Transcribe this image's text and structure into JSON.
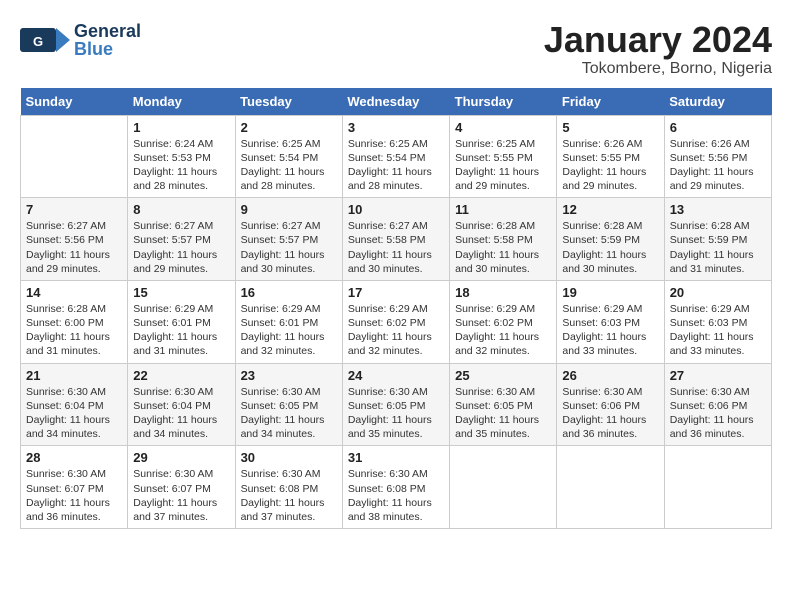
{
  "header": {
    "logo_line1": "General",
    "logo_line2": "Blue",
    "month": "January 2024",
    "location": "Tokombere, Borno, Nigeria"
  },
  "days_of_week": [
    "Sunday",
    "Monday",
    "Tuesday",
    "Wednesday",
    "Thursday",
    "Friday",
    "Saturday"
  ],
  "weeks": [
    [
      {
        "day": "",
        "info": ""
      },
      {
        "day": "1",
        "info": "Sunrise: 6:24 AM\nSunset: 5:53 PM\nDaylight: 11 hours\nand 28 minutes."
      },
      {
        "day": "2",
        "info": "Sunrise: 6:25 AM\nSunset: 5:54 PM\nDaylight: 11 hours\nand 28 minutes."
      },
      {
        "day": "3",
        "info": "Sunrise: 6:25 AM\nSunset: 5:54 PM\nDaylight: 11 hours\nand 28 minutes."
      },
      {
        "day": "4",
        "info": "Sunrise: 6:25 AM\nSunset: 5:55 PM\nDaylight: 11 hours\nand 29 minutes."
      },
      {
        "day": "5",
        "info": "Sunrise: 6:26 AM\nSunset: 5:55 PM\nDaylight: 11 hours\nand 29 minutes."
      },
      {
        "day": "6",
        "info": "Sunrise: 6:26 AM\nSunset: 5:56 PM\nDaylight: 11 hours\nand 29 minutes."
      }
    ],
    [
      {
        "day": "7",
        "info": "Sunrise: 6:27 AM\nSunset: 5:56 PM\nDaylight: 11 hours\nand 29 minutes."
      },
      {
        "day": "8",
        "info": "Sunrise: 6:27 AM\nSunset: 5:57 PM\nDaylight: 11 hours\nand 29 minutes."
      },
      {
        "day": "9",
        "info": "Sunrise: 6:27 AM\nSunset: 5:57 PM\nDaylight: 11 hours\nand 30 minutes."
      },
      {
        "day": "10",
        "info": "Sunrise: 6:27 AM\nSunset: 5:58 PM\nDaylight: 11 hours\nand 30 minutes."
      },
      {
        "day": "11",
        "info": "Sunrise: 6:28 AM\nSunset: 5:58 PM\nDaylight: 11 hours\nand 30 minutes."
      },
      {
        "day": "12",
        "info": "Sunrise: 6:28 AM\nSunset: 5:59 PM\nDaylight: 11 hours\nand 30 minutes."
      },
      {
        "day": "13",
        "info": "Sunrise: 6:28 AM\nSunset: 5:59 PM\nDaylight: 11 hours\nand 31 minutes."
      }
    ],
    [
      {
        "day": "14",
        "info": "Sunrise: 6:28 AM\nSunset: 6:00 PM\nDaylight: 11 hours\nand 31 minutes."
      },
      {
        "day": "15",
        "info": "Sunrise: 6:29 AM\nSunset: 6:01 PM\nDaylight: 11 hours\nand 31 minutes."
      },
      {
        "day": "16",
        "info": "Sunrise: 6:29 AM\nSunset: 6:01 PM\nDaylight: 11 hours\nand 32 minutes."
      },
      {
        "day": "17",
        "info": "Sunrise: 6:29 AM\nSunset: 6:02 PM\nDaylight: 11 hours\nand 32 minutes."
      },
      {
        "day": "18",
        "info": "Sunrise: 6:29 AM\nSunset: 6:02 PM\nDaylight: 11 hours\nand 32 minutes."
      },
      {
        "day": "19",
        "info": "Sunrise: 6:29 AM\nSunset: 6:03 PM\nDaylight: 11 hours\nand 33 minutes."
      },
      {
        "day": "20",
        "info": "Sunrise: 6:29 AM\nSunset: 6:03 PM\nDaylight: 11 hours\nand 33 minutes."
      }
    ],
    [
      {
        "day": "21",
        "info": "Sunrise: 6:30 AM\nSunset: 6:04 PM\nDaylight: 11 hours\nand 34 minutes."
      },
      {
        "day": "22",
        "info": "Sunrise: 6:30 AM\nSunset: 6:04 PM\nDaylight: 11 hours\nand 34 minutes."
      },
      {
        "day": "23",
        "info": "Sunrise: 6:30 AM\nSunset: 6:05 PM\nDaylight: 11 hours\nand 34 minutes."
      },
      {
        "day": "24",
        "info": "Sunrise: 6:30 AM\nSunset: 6:05 PM\nDaylight: 11 hours\nand 35 minutes."
      },
      {
        "day": "25",
        "info": "Sunrise: 6:30 AM\nSunset: 6:05 PM\nDaylight: 11 hours\nand 35 minutes."
      },
      {
        "day": "26",
        "info": "Sunrise: 6:30 AM\nSunset: 6:06 PM\nDaylight: 11 hours\nand 36 minutes."
      },
      {
        "day": "27",
        "info": "Sunrise: 6:30 AM\nSunset: 6:06 PM\nDaylight: 11 hours\nand 36 minutes."
      }
    ],
    [
      {
        "day": "28",
        "info": "Sunrise: 6:30 AM\nSunset: 6:07 PM\nDaylight: 11 hours\nand 36 minutes."
      },
      {
        "day": "29",
        "info": "Sunrise: 6:30 AM\nSunset: 6:07 PM\nDaylight: 11 hours\nand 37 minutes."
      },
      {
        "day": "30",
        "info": "Sunrise: 6:30 AM\nSunset: 6:08 PM\nDaylight: 11 hours\nand 37 minutes."
      },
      {
        "day": "31",
        "info": "Sunrise: 6:30 AM\nSunset: 6:08 PM\nDaylight: 11 hours\nand 38 minutes."
      },
      {
        "day": "",
        "info": ""
      },
      {
        "day": "",
        "info": ""
      },
      {
        "day": "",
        "info": ""
      }
    ]
  ]
}
